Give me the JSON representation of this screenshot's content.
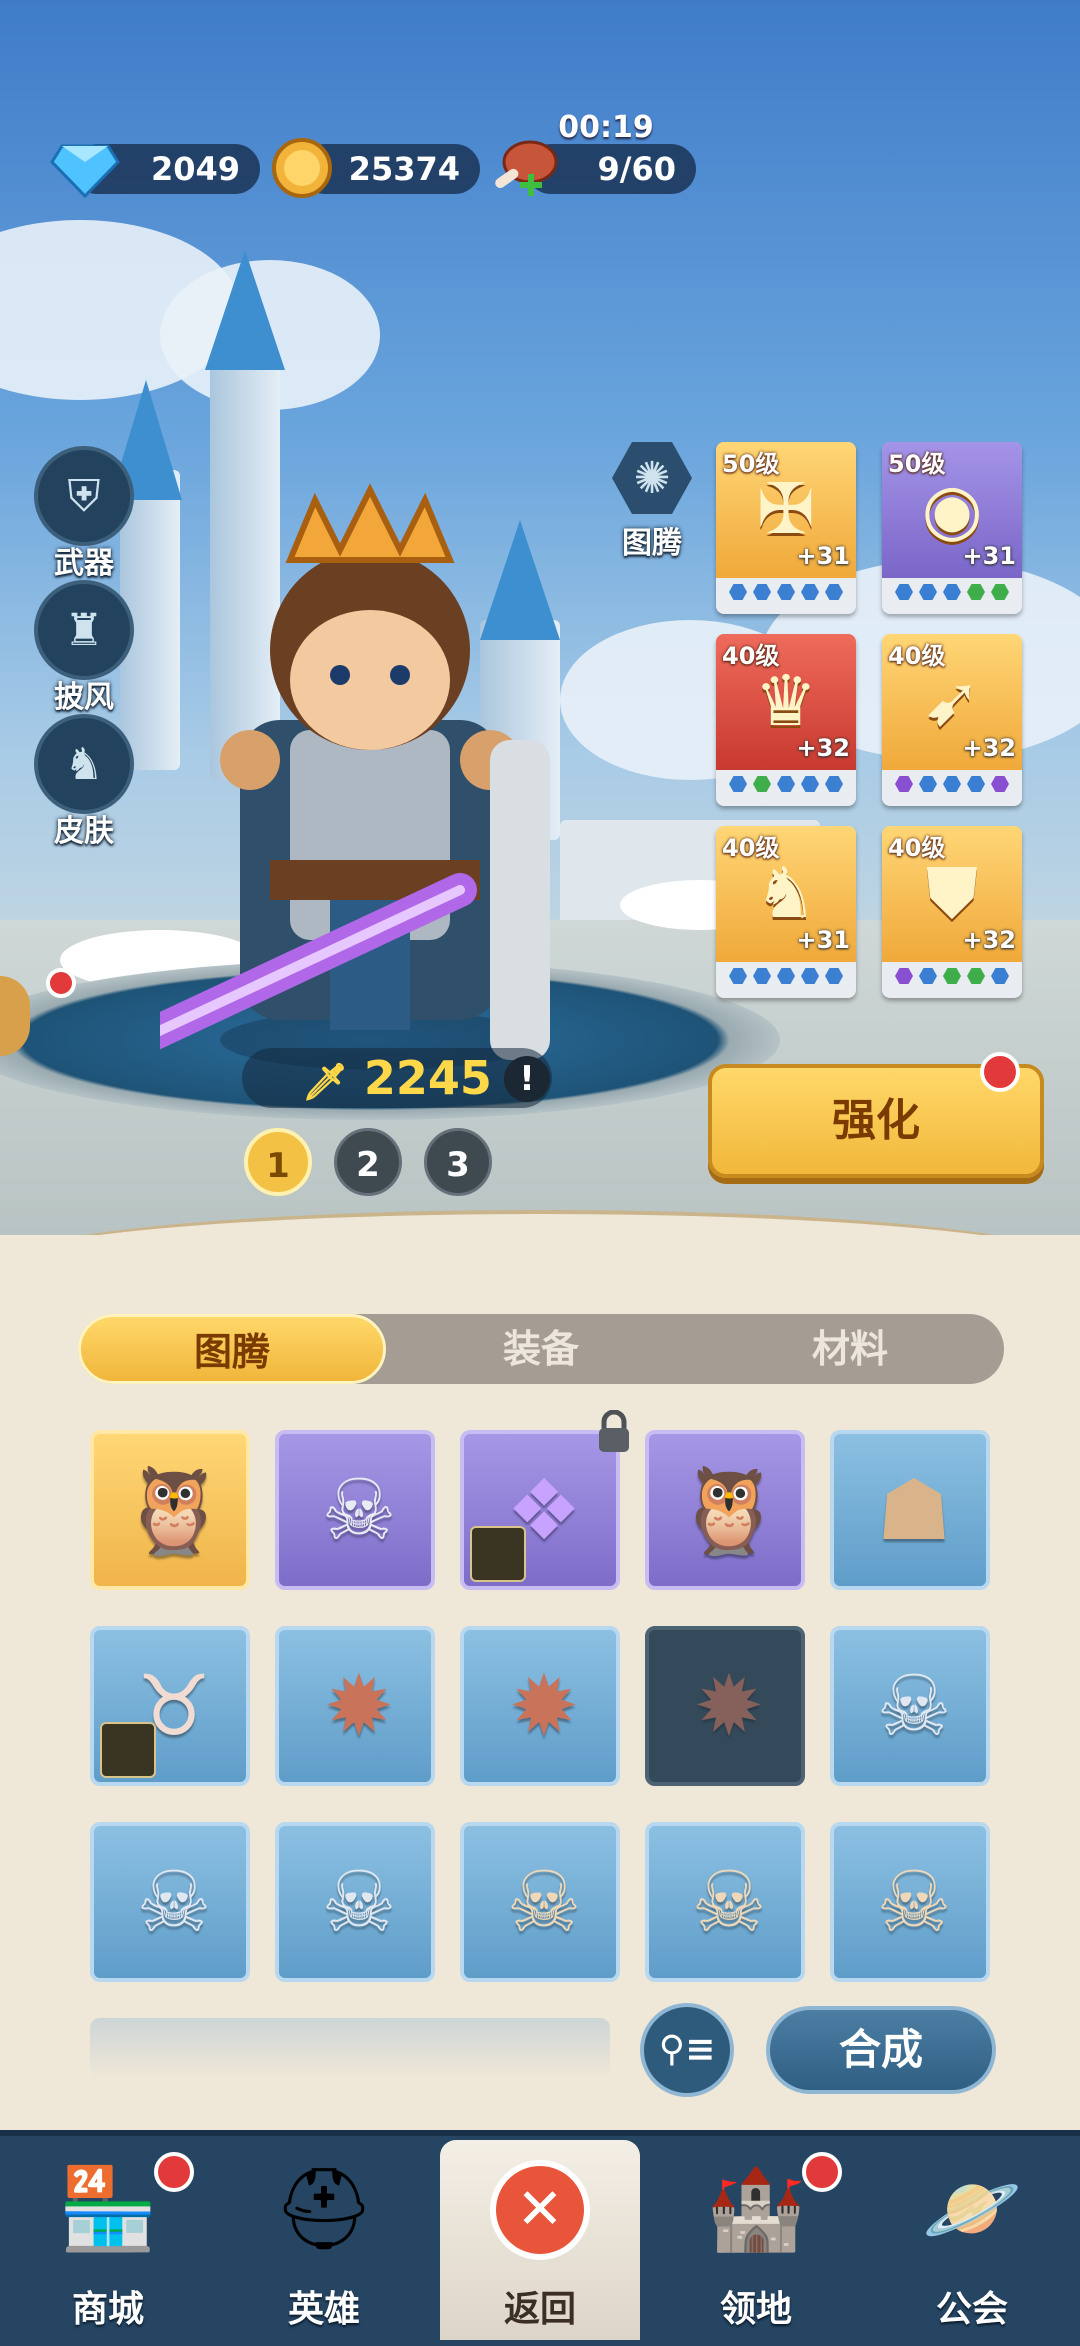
{
  "resources": {
    "gems": "2049",
    "coins": "25374",
    "stamina": "9/60",
    "stamina_timer": "00:19"
  },
  "side_buttons": [
    {
      "label": "武器",
      "icon": "weapon-icon"
    },
    {
      "label": "披风",
      "icon": "cape-icon"
    },
    {
      "label": "皮肤",
      "icon": "skin-icon"
    }
  ],
  "totem_button": {
    "label": "图腾",
    "icon": "totem-icon"
  },
  "equipment": [
    {
      "level": "50级",
      "plus": "+31",
      "tier": "gold",
      "icon": "cross-amulet-icon",
      "dots": [
        "blue",
        "blue",
        "blue",
        "blue",
        "blue"
      ]
    },
    {
      "level": "50级",
      "plus": "+31",
      "tier": "purple",
      "icon": "gem-ring-icon",
      "dots": [
        "blue",
        "blue",
        "blue",
        "green",
        "green"
      ]
    },
    {
      "level": "40级",
      "plus": "+32",
      "tier": "red",
      "icon": "crown-icon",
      "dots": [
        "blue",
        "green",
        "blue",
        "blue",
        "blue"
      ]
    },
    {
      "level": "40级",
      "plus": "+32",
      "tier": "gold",
      "icon": "horn-icon",
      "dots": [
        "purple",
        "blue",
        "blue",
        "blue",
        "purple"
      ]
    },
    {
      "level": "40级",
      "plus": "+31",
      "tier": "gold",
      "icon": "boots-icon",
      "dots": [
        "blue",
        "blue",
        "blue",
        "blue",
        "blue"
      ]
    },
    {
      "level": "40级",
      "plus": "+32",
      "tier": "gold",
      "icon": "armor-icon",
      "dots": [
        "purple",
        "blue",
        "green",
        "green",
        "blue"
      ]
    }
  ],
  "power": "2245",
  "pages": [
    "1",
    "2",
    "3"
  ],
  "enhance_label": "强化",
  "tabs": [
    "图腾",
    "装备",
    "材料"
  ],
  "inventory": [
    {
      "tier": "gold",
      "icon": "owl-mask-icon"
    },
    {
      "tier": "purple",
      "icon": "horned-skull-icon"
    },
    {
      "tier": "purple",
      "icon": "feather-mask-icon"
    },
    {
      "tier": "purple",
      "icon": "owl-mask-icon"
    },
    {
      "tier": "blue",
      "icon": "bear-skull-icon"
    },
    {
      "tier": "blue",
      "icon": "bull-skull-icon"
    },
    {
      "tier": "blue",
      "icon": "tribal-skull-icon"
    },
    {
      "tier": "blue",
      "icon": "tribal-skull-icon"
    },
    {
      "tier": "dark",
      "icon": "tribal-skull-icon"
    },
    {
      "tier": "blue",
      "icon": "silver-skull-icon"
    },
    {
      "tier": "blue",
      "icon": "silver-skull-icon"
    },
    {
      "tier": "blue",
      "icon": "silver-skull-icon"
    },
    {
      "tier": "blue",
      "icon": "cat-skull-icon"
    },
    {
      "tier": "blue",
      "icon": "cat-skull-icon"
    },
    {
      "tier": "blue",
      "icon": "cat-skull-icon"
    }
  ],
  "compose_label": "合成",
  "nav": [
    {
      "label": "商城",
      "icon": "shop-icon",
      "badge": true
    },
    {
      "label": "英雄",
      "icon": "knight-helmet-icon",
      "badge": false
    },
    {
      "label": "返回",
      "icon": "close-icon",
      "badge": false,
      "active": true
    },
    {
      "label": "领地",
      "icon": "castle-icon",
      "badge": true
    },
    {
      "label": "公会",
      "icon": "planet-icon",
      "badge": false
    }
  ],
  "colors": {
    "gold": "#f3c245",
    "badge_red": "#e23a3a",
    "nav_bg": "#254562"
  }
}
